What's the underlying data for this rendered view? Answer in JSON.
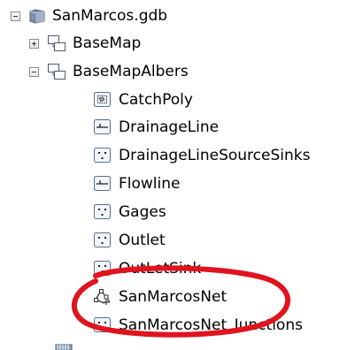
{
  "tree": {
    "root": {
      "label": "SanMarcos.gdb",
      "icon": "geodatabase-icon",
      "expanded": true
    },
    "datasets": [
      {
        "label": "BaseMap",
        "icon": "feature-dataset-icon",
        "expanded": false
      },
      {
        "label": "BaseMapAlbers",
        "icon": "feature-dataset-icon",
        "expanded": true
      }
    ],
    "children": [
      {
        "label": "CatchPoly",
        "icon": "polygon-feature-class-icon"
      },
      {
        "label": "DrainageLine",
        "icon": "line-feature-class-icon"
      },
      {
        "label": "DrainageLineSourceSinks",
        "icon": "point-feature-class-icon"
      },
      {
        "label": "Flowline",
        "icon": "line-feature-class-icon"
      },
      {
        "label": "Gages",
        "icon": "point-feature-class-icon"
      },
      {
        "label": "Outlet",
        "icon": "point-feature-class-icon"
      },
      {
        "label": "OutLetSink",
        "icon": "point-feature-class-icon"
      },
      {
        "label": "SanMarcosNet",
        "icon": "geometric-network-icon",
        "highlighted": true
      },
      {
        "label": "SanMarcosNet_Junctions",
        "icon": "point-feature-class-icon"
      }
    ]
  },
  "annotation": {
    "shape": "ellipse",
    "color": "#e0141e",
    "target": "SanMarcosNet"
  },
  "colors": {
    "selection_ring": "#e0141e",
    "icon_border": "#5a6f8a",
    "icon_fill": "#f2f6fb"
  }
}
